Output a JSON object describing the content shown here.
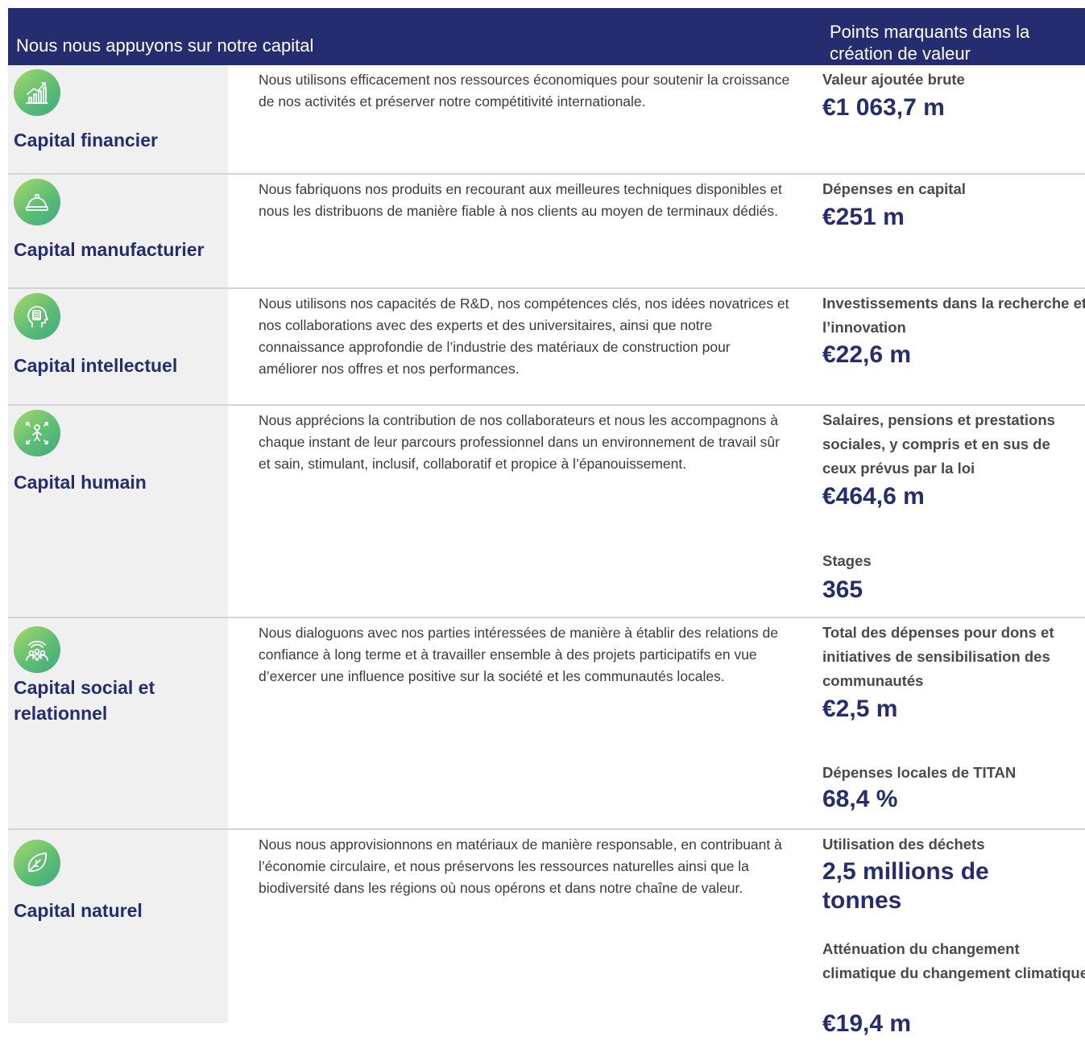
{
  "header": {
    "left_title": "Nous nous appuyons sur notre capital",
    "right_title": "Points marquants dans la création de valeur"
  },
  "rows": [
    {
      "icon": "growth-chart-icon",
      "name": "Capital financier",
      "description": "Nous utilisons efficacement nos ressources économiques pour soutenir la croissance de nos activités et préserver notre compétitivité internationale.",
      "highlights": [
        {
          "label": "Valeur ajoutée brute",
          "value": "€1 063,7 m"
        }
      ]
    },
    {
      "icon": "hard-hat-icon",
      "name": "Capital manufacturier",
      "description": "Nous fabriquons nos produits en recourant aux meilleures techniques disponibles et nous les distribuons de manière fiable à nos clients au moyen de terminaux dédiés.",
      "highlights": [
        {
          "label": "Dépenses en capital",
          "value": "€251 m"
        }
      ]
    },
    {
      "icon": "head-idea-icon",
      "name": "Capital intellectuel",
      "description": "Nous utilisons nos capacités de R&D, nos compétences clés, nos idées novatrices et nos collaborations avec des experts et des universitaires, ainsi que notre connaissance approfondie de l’industrie des matériaux de construction pour améliorer nos offres et nos performances.",
      "highlights": [
        {
          "label": "Investissements dans la recherche et l’innovation",
          "value": "€22,6 m"
        }
      ]
    },
    {
      "icon": "person-expand-icon",
      "name": "Capital humain",
      "description": "Nous apprécions la contribution de nos collaborateurs et nous les accompagnons à chaque instant de leur parcours professionnel dans un environnement de travail sûr et sain, stimulant, inclusif, collaboratif et propice à l’épanouissement.",
      "highlights": [
        {
          "label": "Salaires, pensions et prestations sociales, y compris et en sus de ceux prévus par la loi",
          "value": "€464,6 m"
        },
        {
          "label": "Stages",
          "value": "365"
        }
      ]
    },
    {
      "icon": "community-signal-icon",
      "name": "Capital social et relationnel",
      "description": "Nous dialoguons avec nos parties intéressées de manière à établir des relations de confiance à long terme et à travailler ensemble à des projets participatifs en vue d’exercer une influence positive sur la société et les communautés locales.",
      "highlights": [
        {
          "label": "Total des dépenses pour dons et initiatives de sensibilisation des communautés",
          "value": "€2,5 m"
        },
        {
          "label": "Dépenses locales de TITAN",
          "value": "68,4 %"
        }
      ]
    },
    {
      "icon": "leaf-icon",
      "name": "Capital naturel",
      "description": "Nous nous approvisionnons en matériaux de manière responsable, en contribuant à l’économie circulaire, et nous préservons les ressources naturelles ainsi que la biodiversité dans les régions où nous opérons et dans notre chaîne de valeur.",
      "highlights": [
        {
          "label": "Utilisation des déchets",
          "value": "2,5 millions de tonnes"
        },
        {
          "label": "Atténuation du changement climatique du changement climatique",
          "value": "€19,4 m"
        }
      ]
    }
  ]
}
